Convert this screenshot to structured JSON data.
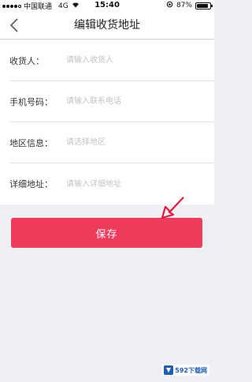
{
  "status_bar": {
    "carrier": "中国联通",
    "network": "4G",
    "time": "15:40",
    "battery": "87%",
    "battery_level": 0.87
  },
  "nav": {
    "title": "编辑收货地址",
    "back_icon": "chevron-left-icon"
  },
  "form": {
    "rows": [
      {
        "label": "收货人：",
        "placeholder": "请输入收货人"
      },
      {
        "label": "手机号码：",
        "placeholder": "请输入联系电话"
      },
      {
        "label": "地区信息：",
        "placeholder": "请选择地区"
      },
      {
        "label": "详细地址：",
        "placeholder": "请输入详细地址"
      }
    ]
  },
  "actions": {
    "save_label": "保存"
  },
  "colors": {
    "accent": "#f03b5c",
    "background": "#efeff4"
  },
  "watermark": {
    "text": "592下载网"
  }
}
